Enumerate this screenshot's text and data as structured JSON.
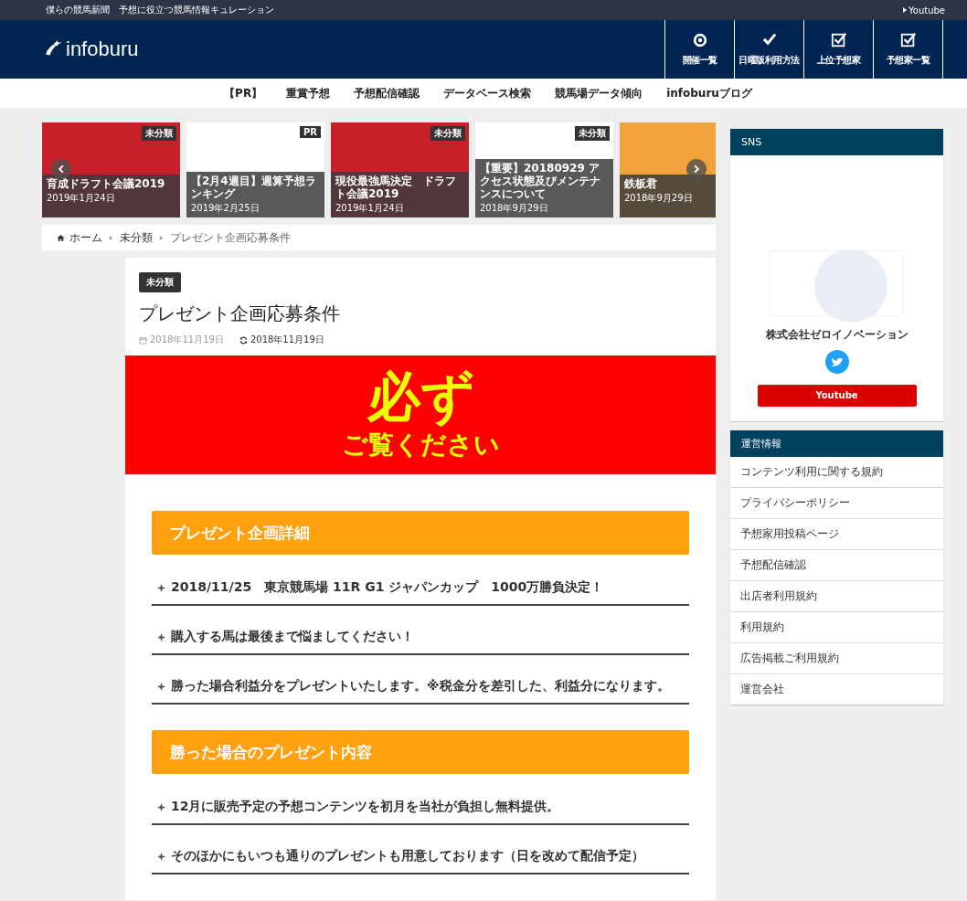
{
  "top_bar": {
    "tagline": "僕らの競馬新聞　予想に役立つ競馬情報キュレーション",
    "link": "Youtube"
  },
  "header": {
    "logo": "infoburu",
    "nav_icons": [
      {
        "label": "開催一覧",
        "kind": "target"
      },
      {
        "label": "日曜版利用方法",
        "kind": "check"
      },
      {
        "label": "上位予想家",
        "kind": "checkbox"
      },
      {
        "label": "予想家一覧",
        "kind": "checkbox"
      }
    ]
  },
  "menu": [
    "【PR】",
    "重賞予想",
    "予想配信確認",
    "データベース検索",
    "競馬場データ傾向",
    "infoburuブログ"
  ],
  "slider": [
    {
      "category": "未分類",
      "title": "育成ドラフト会議2019",
      "date": "2019年1月24日"
    },
    {
      "category": "PR",
      "title": "【2月4週目】週算予想ランキング",
      "date": "2019年2月25日"
    },
    {
      "category": "未分類",
      "title": "現役最強馬決定　ドラフト会議2019",
      "date": "2019年1月24日"
    },
    {
      "category": "未分類",
      "title": "【重要】20180929 アクセス状態及びメンテナンスについて",
      "date": "2018年9月29日"
    },
    {
      "title": "鉄板君",
      "date": "2018年9月29日"
    }
  ],
  "breadcrumb": [
    "ホーム",
    "未分類",
    "プレゼント企画応募条件"
  ],
  "article": {
    "category": "未分類",
    "title": "プレゼント企画応募条件",
    "published": "2018年11月19日",
    "updated": "2018年11月19日",
    "banner": {
      "line_1": "必ず",
      "line_2": "ご覧ください"
    },
    "sections": [
      {
        "heading": "プレゼント企画詳細",
        "items": [
          "2018/11/25　東京競馬場 11R G1 ジャパンカップ　1000万勝負決定！",
          "購入する馬は最後まで悩ましてください！",
          "勝った場合利益分をプレゼントいたします。※税金分を差引した、利益分になります。"
        ]
      },
      {
        "heading": "勝った場合のプレゼント内容",
        "items": [
          "12月に販売予定の予想コンテンツを初月を当社が負担し無料提供。",
          "そのほかにもいつも通りのプレゼントも用意しております（日を改めて配信予定）"
        ]
      }
    ]
  },
  "sidebar": {
    "sns": {
      "title": "SNS",
      "company": "株式会社ゼロイノベーション",
      "button": "Youtube"
    },
    "info": {
      "title": "運営情報",
      "items": [
        "コンテンツ利用に関する規約",
        "プライバシーポリシー",
        "予想家用投稿ページ",
        "予想配信確認",
        "出店者利用規約",
        "利用規約",
        "広告掲載ご利用規約",
        "運営会社"
      ]
    }
  }
}
